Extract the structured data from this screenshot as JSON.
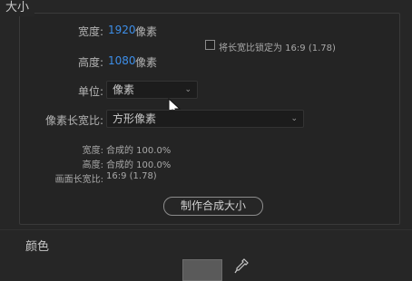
{
  "size": {
    "title": "大小",
    "width_label": "宽度:",
    "width_value": "1920",
    "width_unit": "像素",
    "height_label": "高度:",
    "height_value": "1080",
    "height_unit": "像素",
    "lock_label": "将长宽比锁定为 16:9 (1.78)",
    "unit_label": "单位:",
    "unit_value": "像素",
    "pixel_aspect_label": "像素长宽比:",
    "pixel_aspect_value": "方形像素",
    "info": {
      "width_label": "宽度:",
      "width_value": "合成的 100.0%",
      "height_label": "高度:",
      "height_value": "合成的 100.0%",
      "frame_aspect_label": "画面长宽比:",
      "frame_aspect_value": "16:9 (1.78)"
    },
    "make_comp_size_button": "制作合成大小"
  },
  "color": {
    "title": "颜色",
    "swatch_color": "#5a5a5a"
  },
  "icons": {
    "dropdown": "chevron-down-icon",
    "cursor": "mouse-pointer-icon",
    "eyedropper": "eyedropper-icon"
  }
}
